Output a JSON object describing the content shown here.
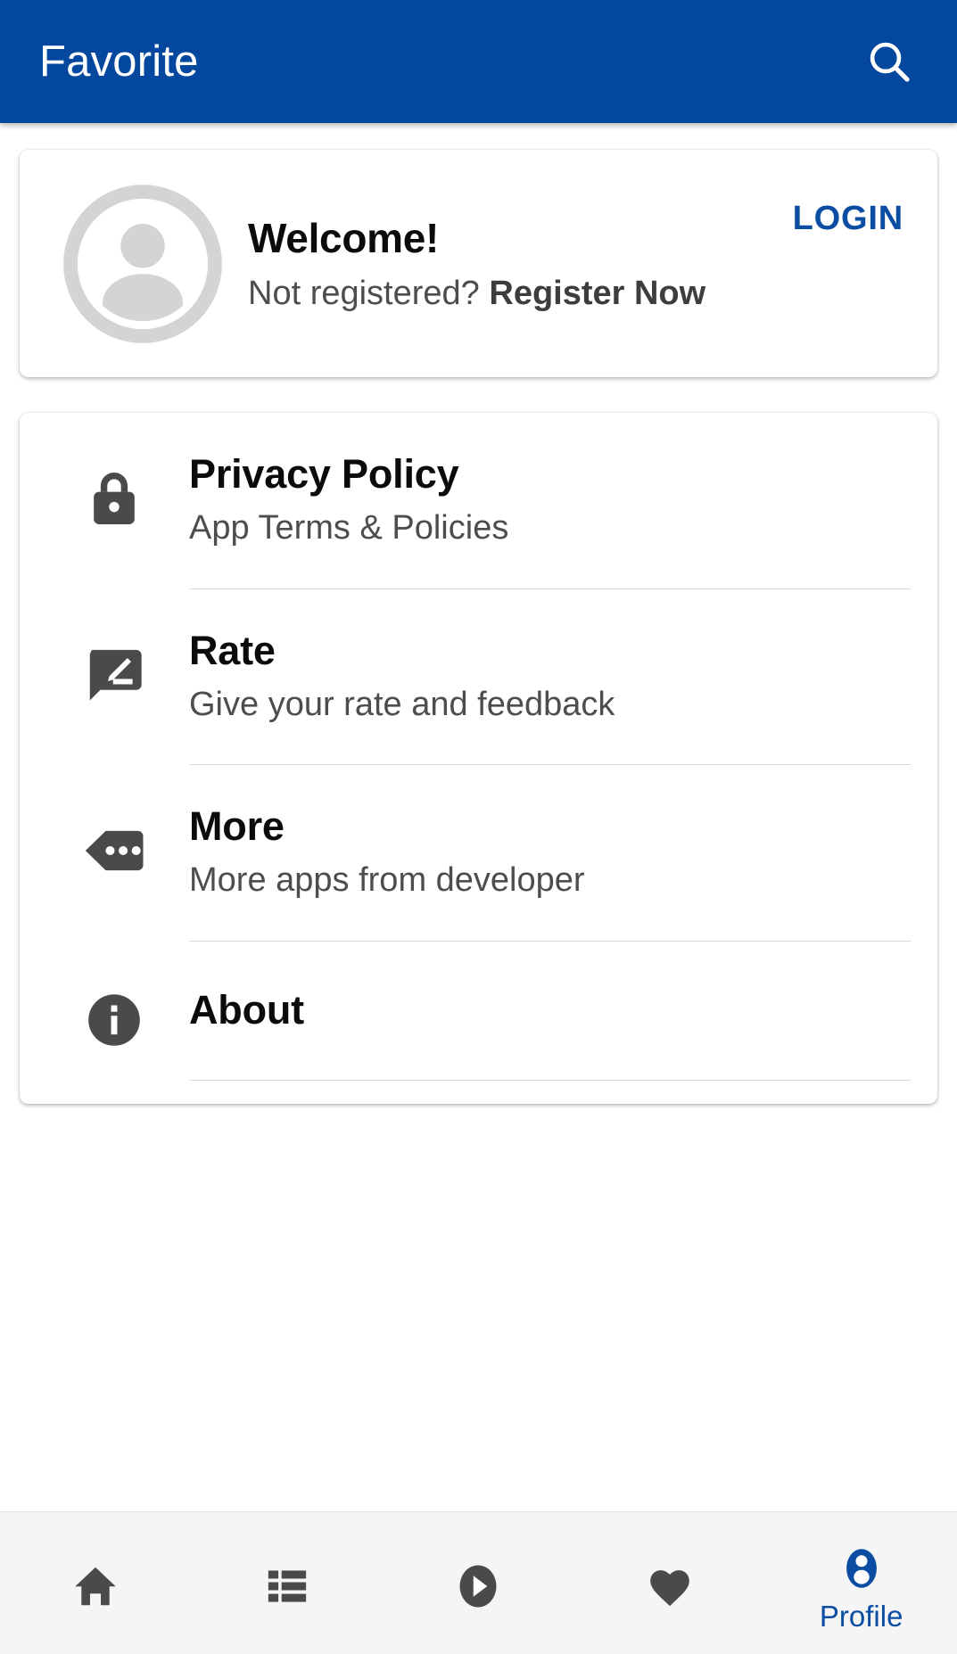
{
  "appbar": {
    "title": "Favorite",
    "search_icon": "search-icon",
    "background_color": "#04479E",
    "title_color": "#FFFFFF"
  },
  "welcome_card": {
    "avatar_icon": "account-circle-icon",
    "title": "Welcome!",
    "subtitle_prefix": "Not registered?",
    "register_label": "Register Now",
    "login_label": "LOGIN",
    "login_color": "#0B4DA2"
  },
  "menu": {
    "items": [
      {
        "icon": "lock-icon",
        "title": "Privacy Policy",
        "subtitle": "App Terms & Policies",
        "divider": true
      },
      {
        "icon": "rate-review-icon",
        "title": "Rate",
        "subtitle": "Give your rate and feedback",
        "divider": true
      },
      {
        "icon": "more-tag-icon",
        "title": "More",
        "subtitle": "More apps from developer",
        "divider": true
      },
      {
        "icon": "info-icon",
        "title": "About",
        "subtitle": "",
        "divider": true
      }
    ]
  },
  "bottom_nav": {
    "items": [
      {
        "icon": "home-icon",
        "label": "",
        "active": false
      },
      {
        "icon": "list-icon",
        "label": "",
        "active": false
      },
      {
        "icon": "play-circle-icon",
        "label": "",
        "active": false
      },
      {
        "icon": "heart-icon",
        "label": "",
        "active": false
      },
      {
        "icon": "person-icon",
        "label": "Profile",
        "active": true
      }
    ],
    "active_color": "#0B4DA2",
    "inactive_color": "#4A4A4A",
    "background_color": "#F5F5F5"
  }
}
